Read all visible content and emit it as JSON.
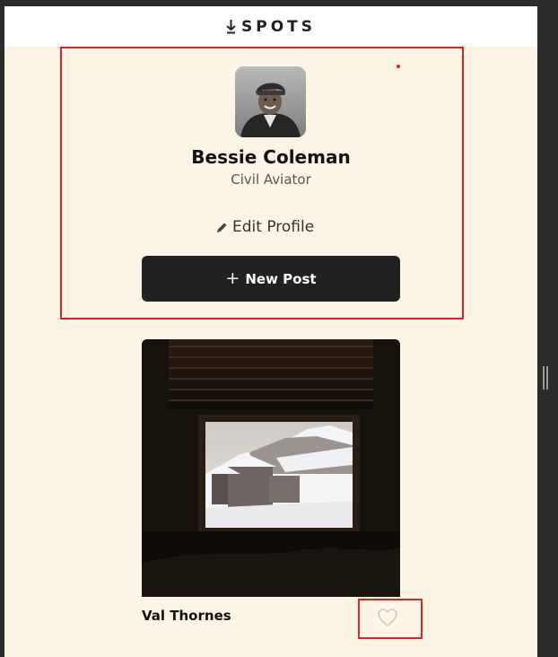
{
  "header": {
    "logo_icon": "spots-logo-icon",
    "logo_text": "SPOTS"
  },
  "profile": {
    "name": "Bessie Coleman",
    "job": "Civil Aviator",
    "edit_icon": "pencil-icon",
    "edit_label": "Edit Profile",
    "new_post_icon": "plus-icon",
    "new_post_label": "New Post"
  },
  "cards": [
    {
      "title": "Val Thornes",
      "like_icon": "heart-icon",
      "liked": false
    }
  ],
  "colors": {
    "page_bg": "#fcf4e4",
    "header_bg": "#ffffff",
    "button_bg": "#212121",
    "highlight": "#e2222b"
  }
}
